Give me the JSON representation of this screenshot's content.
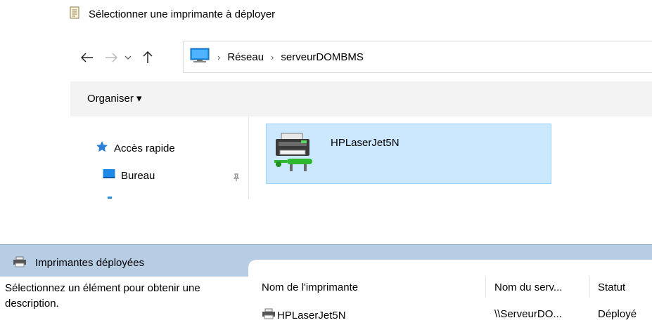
{
  "dialog": {
    "title": "Sélectionner une imprimante à déployer"
  },
  "nav": {
    "back": "back-arrow-icon",
    "forward": "forward-arrow-icon",
    "recent": "chevron-down-icon",
    "up": "up-arrow-icon"
  },
  "address": {
    "crumbs": [
      "Réseau",
      "serveurDOMBMS"
    ]
  },
  "toolbar": {
    "organize_label": "Organiser ▾"
  },
  "sidebar": {
    "items": [
      {
        "label": "Accès rapide",
        "icon": "star-icon"
      },
      {
        "label": "Bureau",
        "icon": "desktop-icon"
      }
    ]
  },
  "content": {
    "items": [
      {
        "label": "HPLaserJet5N",
        "icon": "network-printer-icon"
      }
    ]
  },
  "deployed": {
    "header": "Imprimantes déployées",
    "description": "Sélectionnez un élément pour obtenir une description.",
    "columns": [
      "Nom de l'imprimante",
      "Nom du serv...",
      "Statut"
    ],
    "rows": [
      {
        "name": "HPLaserJet5N",
        "server": "\\\\ServeurDO...",
        "status": "Déployé"
      }
    ]
  },
  "colors": {
    "selection": "#cce8ff",
    "selection_border": "#99d1ff",
    "panel_header": "#b7cde4",
    "accent": "#0078d7"
  }
}
